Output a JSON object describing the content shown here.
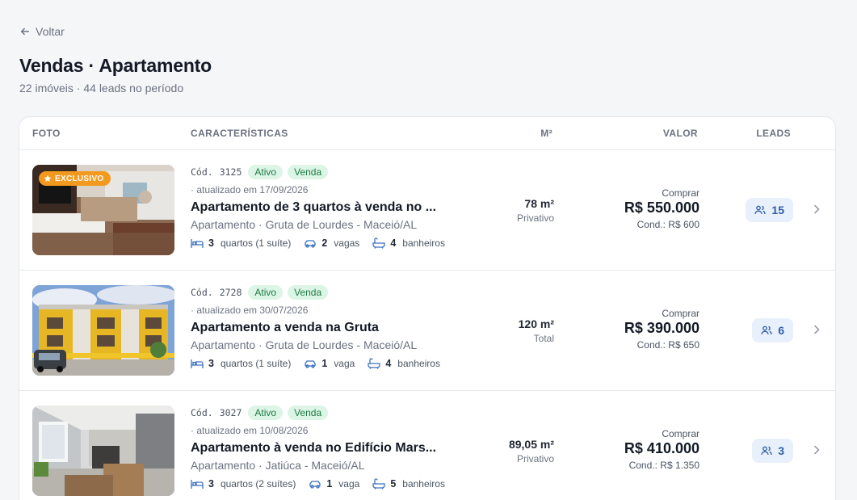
{
  "nav": {
    "back_label": "Voltar"
  },
  "page": {
    "title": "Vendas · Apartamento",
    "subtitle": "22 imóveis · 44 leads no período"
  },
  "table": {
    "headers": {
      "foto": "FOTO",
      "caracteristicas": "CARACTERÍSTICAS",
      "m2": "M²",
      "valor": "VALOR",
      "leads": "LEADS"
    },
    "rows": [
      {
        "exclusive_label": "EXCLUSIVO",
        "code_prefix": "Cód.",
        "code": "3125",
        "status": "Ativo",
        "type": "Venda",
        "updated": "· atualizado em 17/09/2026",
        "title": "Apartamento de 3 quartos à venda no ...",
        "address": "Apartamento · Gruta de Lourdes - Maceió/AL",
        "bedrooms": "3",
        "bedrooms_label": "quartos (1 suíte)",
        "parking": "2",
        "parking_label": "vagas",
        "bathrooms": "4",
        "bathrooms_label": "banheiros",
        "area": "78 m²",
        "area_type": "Privativo",
        "price_label": "Comprar",
        "price": "R$ 550.000",
        "condo": "Cond.: R$ 600",
        "leads": "15"
      },
      {
        "exclusive_label": "",
        "code_prefix": "Cód.",
        "code": "2728",
        "status": "Ativo",
        "type": "Venda",
        "updated": "· atualizado em 30/07/2026",
        "title": "Apartamento a venda na Gruta",
        "address": "Apartamento · Gruta de Lourdes - Maceió/AL",
        "bedrooms": "3",
        "bedrooms_label": "quartos (1 suíte)",
        "parking": "1",
        "parking_label": "vaga",
        "bathrooms": "4",
        "bathrooms_label": "banheiros",
        "area": "120 m²",
        "area_type": "Total",
        "price_label": "Comprar",
        "price": "R$ 390.000",
        "condo": "Cond.: R$ 650",
        "leads": "6"
      },
      {
        "exclusive_label": "",
        "code_prefix": "Cód.",
        "code": "3027",
        "status": "Ativo",
        "type": "Venda",
        "updated": "· atualizado em 10/08/2026",
        "title": "Apartamento à venda no Edifício Mars...",
        "address": "Apartamento · Jatiúca - Maceió/AL",
        "bedrooms": "3",
        "bedrooms_label": "quartos (2 suítes)",
        "parking": "1",
        "parking_label": "vaga",
        "bathrooms": "5",
        "bathrooms_label": "banheiros",
        "area": "89,05 m²",
        "area_type": "Privativo",
        "price_label": "Comprar",
        "price": "R$ 410.000",
        "condo": "Cond.: R$ 1.350",
        "leads": "3"
      }
    ]
  },
  "colors": {
    "accent": "#2d5da8",
    "status_badge_bg": "#dcf5e6",
    "status_badge_text": "#1f7a45",
    "exclusive_badge": "#f39a1e"
  },
  "icons": [
    "arrow-left-icon",
    "star-icon",
    "bed-icon",
    "car-icon",
    "bath-icon",
    "users-icon",
    "chevron-right-icon"
  ]
}
